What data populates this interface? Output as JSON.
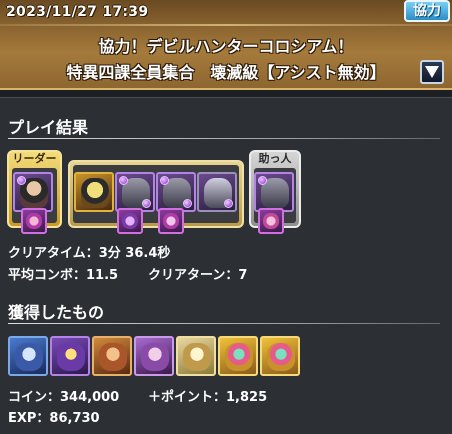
{
  "header": {
    "timestamp": "2023/11/27 17:39",
    "mode_badge": "協力",
    "dungeon_title": "協力！デビルハンターコロシアム！",
    "floor_title": "特異四課全員集合　壊滅級【アシスト無効】"
  },
  "result": {
    "section_title": "プレイ結果",
    "leader_label": "リーダー",
    "helper_label": "助っ人",
    "clear_time": "クリアタイム：3分 36.4秒",
    "avg_combo": "平均コンボ：11.5",
    "clear_turns": "クリアターン：7"
  },
  "drops": {
    "section_title": "獲得したもの",
    "coins": "コイン：344,000",
    "points": "＋ポイント：1,825",
    "exp": "EXP：86,730"
  },
  "colors": {
    "accent_gold": "#c89a2c",
    "attribute_dark": "#8a2bd6",
    "badge_blue": "#2b8ec7"
  }
}
